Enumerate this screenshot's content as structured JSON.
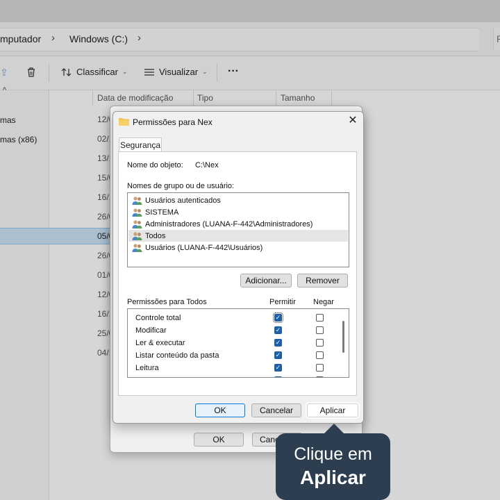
{
  "explorer": {
    "breadcrumb": [
      "mputador",
      "Windows (C:)"
    ],
    "search_stub": "P",
    "toolbar": {
      "sort_label": "Classificar",
      "view_label": "Visualizar",
      "more_label": "···"
    },
    "columns": [
      "Data de modificação",
      "Tipo",
      "Tamanho"
    ],
    "nav_items": [
      "mas",
      "mas (x86)"
    ],
    "date_fragments": [
      "12/0",
      "02/1",
      "13/1",
      "15/0",
      "16/1",
      "26/0",
      "05/0",
      "26/0",
      "01/0",
      "12/0",
      "16/1",
      "25/0",
      "04/1"
    ]
  },
  "back_dialog": {
    "ok_label": "OK",
    "cancel_label": "Canc"
  },
  "dialog": {
    "title": "Permissões para Nex",
    "tab_label": "Segurança",
    "object_name_label": "Nome do objeto:",
    "object_name_value": "C:\\Nex",
    "group_label": "Nomes de grupo ou de usuário:",
    "users": [
      {
        "name": "Usuários autenticados",
        "selected": false
      },
      {
        "name": "SISTEMA",
        "selected": false
      },
      {
        "name": "Administradores (LUANA-F-442\\Administradores)",
        "selected": false
      },
      {
        "name": "Todos",
        "selected": true
      },
      {
        "name": "Usuários (LUANA-F-442\\Usuários)",
        "selected": false
      }
    ],
    "add_label": "Adicionar...",
    "remove_label": "Remover",
    "perm_title": "Permissões para Todos",
    "allow_header": "Permitir",
    "deny_header": "Negar",
    "permissions": [
      {
        "name": "Controle total",
        "allow": true,
        "deny": false
      },
      {
        "name": "Modificar",
        "allow": true,
        "deny": false
      },
      {
        "name": "Ler & executar",
        "allow": true,
        "deny": false
      },
      {
        "name": "Listar conteúdo da pasta",
        "allow": true,
        "deny": false
      },
      {
        "name": "Leitura",
        "allow": true,
        "deny": false
      }
    ],
    "ok_label": "OK",
    "cancel_label": "Cancelar",
    "apply_label": "Aplicar"
  },
  "callout": {
    "line1": "Clique em",
    "line2": "Aplicar"
  },
  "colors": {
    "accent": "#1f5fa8",
    "callout_bg": "#2c3e50",
    "selection": "#cce4f7"
  }
}
